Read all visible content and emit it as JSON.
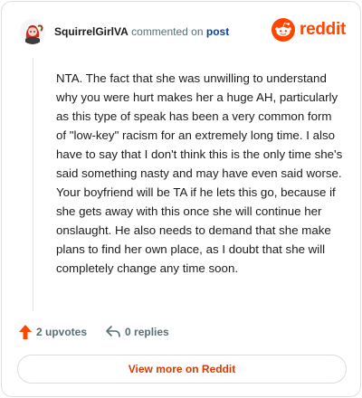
{
  "header": {
    "username": "SquirrelGirlVA",
    "action_text": "commented on",
    "post_link": "post",
    "logo_wordmark": "reddit",
    "avatar_icon": "squirrel-avatar-icon",
    "brand_color": "#ff4500"
  },
  "comment": {
    "body": "NTA. The fact that she was unwilling to understand why you were hurt makes her a huge AH, particularly as this type of speak has been a very common form of \"low-key\" racism for an extremely long time. I also have to say that I don't think this is the only time she's said something nasty and may have even said worse. Your boyfriend will be TA if he lets this go, because if she gets away with this once she will continue her onslaught. He also needs to demand that she make plans to find her own place, as I doubt that she will completely change any time soon."
  },
  "stats": {
    "upvotes": "2 upvotes",
    "replies": "0 replies",
    "upvote_icon": "upvote-arrow-icon",
    "reply_icon": "reply-icon"
  },
  "footer": {
    "view_more_label": "View more on Reddit"
  }
}
